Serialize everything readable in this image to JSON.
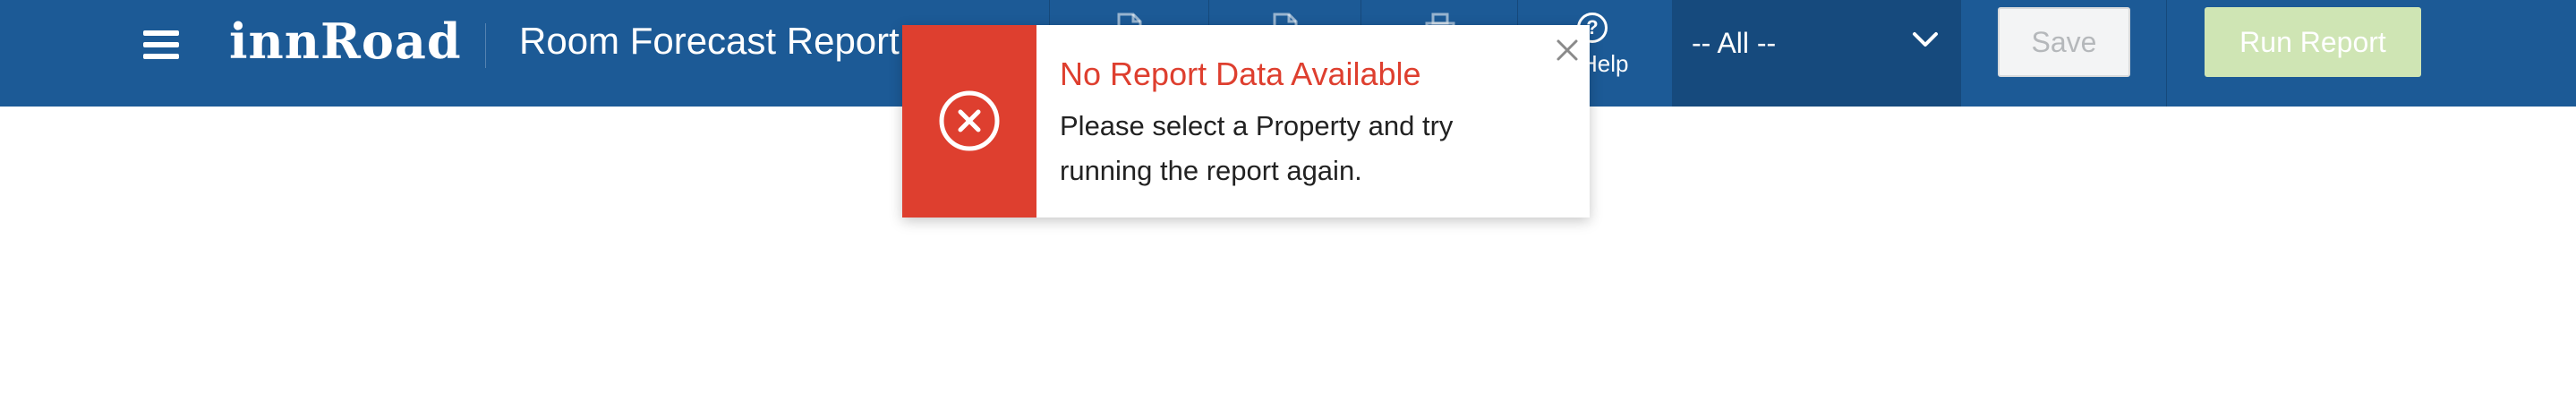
{
  "app": {
    "logo_text": "innRoad",
    "page_title": "Room Forecast Report"
  },
  "toolbar": {
    "tools": [
      {
        "icon": "document-icon"
      },
      {
        "icon": "document-icon"
      },
      {
        "icon": "print-icon"
      }
    ],
    "help_label": "Help",
    "help_glyph": "?",
    "property_select_value": "-- All --",
    "save_label": "Save",
    "run_report_label": "Run Report"
  },
  "notification": {
    "title": "No Report Data Available",
    "message": "Please select a Property and try running the report again."
  },
  "colors": {
    "topbar": "#1c5a96",
    "error": "#de3f2f",
    "run_button": "#cfe5b4"
  }
}
